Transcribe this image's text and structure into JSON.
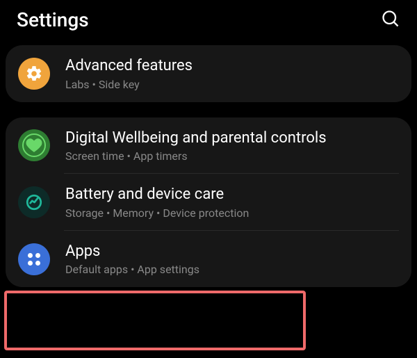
{
  "header": {
    "title": "Settings"
  },
  "groups": [
    {
      "items": [
        {
          "id": "advanced-features",
          "title": "Advanced features",
          "subtitle": "Labs  •  Side key"
        }
      ]
    },
    {
      "items": [
        {
          "id": "digital-wellbeing",
          "title": "Digital Wellbeing and parental controls",
          "subtitle": "Screen time  •  App timers"
        },
        {
          "id": "battery-device-care",
          "title": "Battery and device care",
          "subtitle": "Storage  •  Memory  •  Device protection"
        },
        {
          "id": "apps",
          "title": "Apps",
          "subtitle": "Default apps  •  App settings"
        }
      ]
    }
  ]
}
